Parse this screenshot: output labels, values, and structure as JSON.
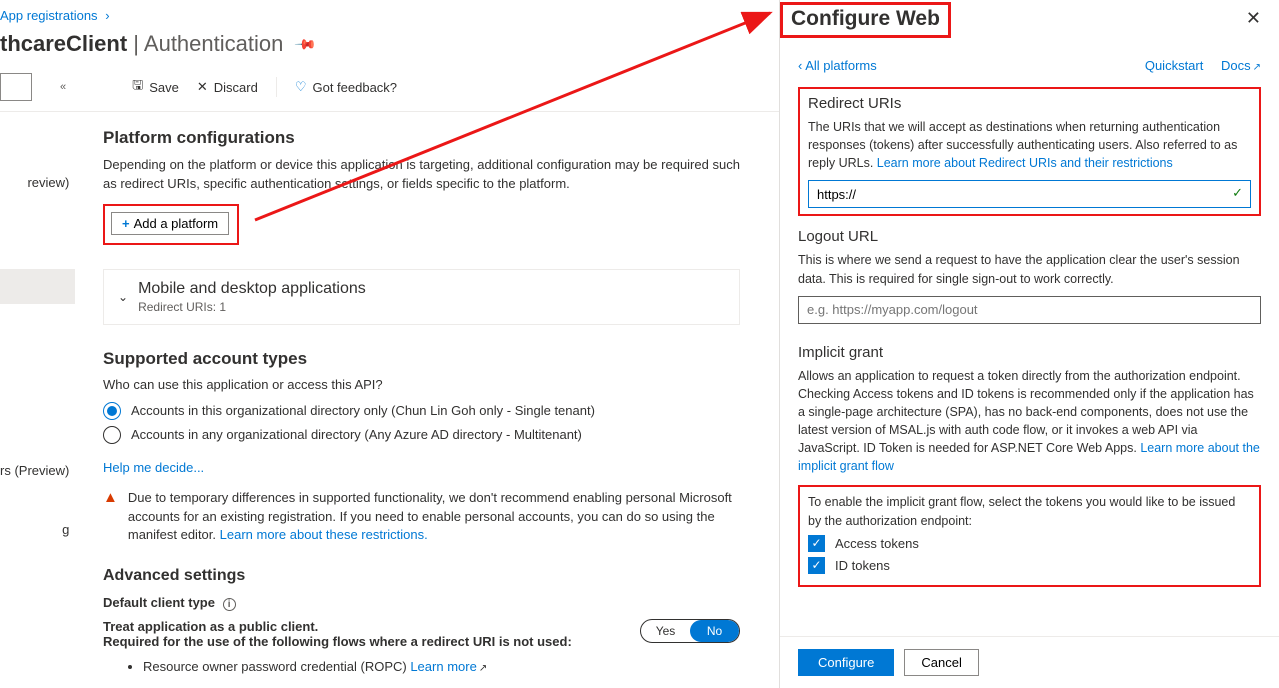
{
  "breadcrumb": {
    "parent": "App registrations"
  },
  "header": {
    "app_name": "thcareClient",
    "section": "Authentication"
  },
  "toolbar": {
    "save": "Save",
    "discard": "Discard",
    "feedback": "Got feedback?"
  },
  "leftnav": {
    "item1": "review)",
    "item2": "rs (Preview)",
    "item3": "g"
  },
  "platform": {
    "heading": "Platform configurations",
    "desc": "Depending on the platform or device this application is targeting, additional configuration may be required such as redirect URIs, specific authentication settings, or fields specific to the platform.",
    "add_btn": "Add a platform",
    "collapse_title": "Mobile and desktop applications",
    "collapse_sub": "Redirect URIs: 1"
  },
  "account_types": {
    "heading": "Supported account types",
    "question": "Who can use this application or access this API?",
    "opt1": "Accounts in this organizational directory only (Chun Lin Goh only - Single tenant)",
    "opt2": "Accounts in any organizational directory (Any Azure AD directory - Multitenant)",
    "help_link": "Help me decide...",
    "warning": "Due to temporary differences in supported functionality, we don't recommend enabling personal Microsoft accounts for an existing registration. If you need to enable personal accounts, you can do so using the manifest editor. ",
    "warning_link": "Learn more about these restrictions."
  },
  "advanced": {
    "heading": "Advanced settings",
    "default_client": "Default client type",
    "public_client": "Treat application as a public client.",
    "required_note": "Required for the use of the following flows where a redirect URI is not used:",
    "yes": "Yes",
    "no": "No",
    "flow1": "Resource owner password credential (ROPC) ",
    "flow1_link": "Learn more"
  },
  "panel": {
    "title": "Configure Web",
    "all_platforms": "All platforms",
    "quickstart": "Quickstart",
    "docs": "Docs",
    "redirect": {
      "label": "Redirect URIs",
      "desc": "The URIs that we will accept as destinations when returning authentication responses (tokens) after successfully authenticating users. Also referred to as reply URLs. ",
      "learn": "Learn more about Redirect URIs and their restrictions",
      "value": "https://"
    },
    "logout": {
      "label": "Logout URL",
      "desc": "This is where we send a request to have the application clear the user's session data. This is required for single sign-out to work correctly.",
      "placeholder": "e.g. https://myapp.com/logout"
    },
    "implicit": {
      "label": "Implicit grant",
      "desc": "Allows an application to request a token directly from the authorization endpoint. Checking Access tokens and ID tokens is recommended only if the application has a single-page architecture (SPA), has no back-end components, does not use the latest version of MSAL.js with auth code flow, or it invokes a web API via JavaScript. ID Token is needed for ASP.NET Core Web Apps. ",
      "learn": "Learn more about the implicit grant flow",
      "enable_note": "To enable the implicit grant flow, select the tokens you would like to be issued by the authorization endpoint:",
      "cb1": "Access tokens",
      "cb2": "ID tokens"
    },
    "configure": "Configure",
    "cancel": "Cancel"
  }
}
